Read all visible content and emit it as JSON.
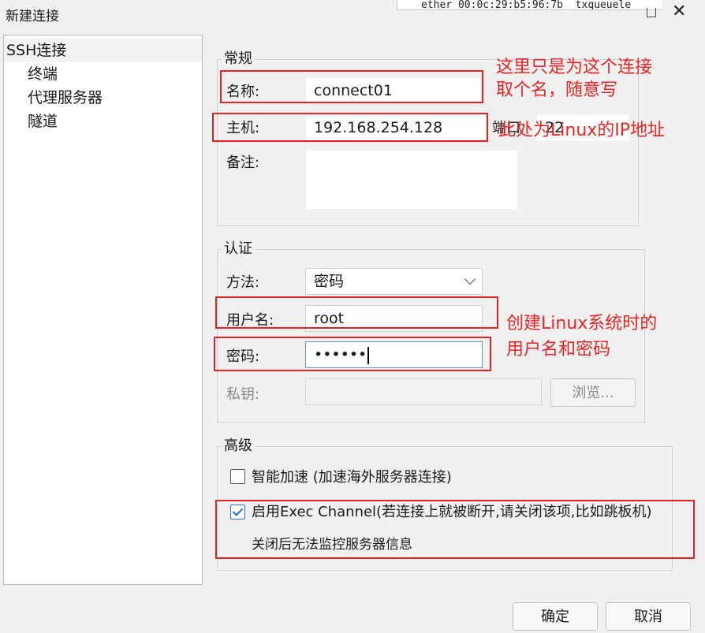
{
  "window": {
    "title": "新建连接",
    "close_glyph": "✕",
    "background_terminal_text": "ether 00:0c:29:b5:96:7b  txqueuele"
  },
  "sidebar": {
    "items": [
      {
        "label": "SSH连接",
        "selected": true
      },
      {
        "label": "终端"
      },
      {
        "label": "代理服务器"
      },
      {
        "label": "隧道"
      }
    ]
  },
  "general": {
    "title": "常规",
    "name_label": "名称:",
    "name_value": "connect01",
    "host_label": "主机:",
    "host_value": "192.168.254.128",
    "port_label": "端口",
    "port_value": "22",
    "remark_label": "备注:",
    "remark_value": ""
  },
  "auth": {
    "title": "认证",
    "method_label": "方法:",
    "method_value": "密码",
    "username_label": "用户名:",
    "username_value": "root",
    "password_label": "密码:",
    "password_value": "••••••",
    "privatekey_label": "私钥:",
    "privatekey_value": "",
    "browse_label": "浏览..."
  },
  "advanced": {
    "title": "高级",
    "smart_accel_label": "智能加速 (加速海外服务器连接)",
    "smart_accel_checked": false,
    "exec_channel_label": "启用Exec Channel(若连接上就被断开,请关闭该项,比如跳板机)",
    "exec_channel_checked": true,
    "exec_channel_note": "关闭后无法监控服务器信息"
  },
  "buttons": {
    "ok": "确定",
    "cancel": "取消"
  },
  "annotations": {
    "name_note_line1": "这里只是为这个连接",
    "name_note_line2": "取个名，随意写",
    "host_note": "此处为Linux的IP地址",
    "credentials_note_line1": "创建Linux系统时的",
    "credentials_note_line2": "用户名和密码",
    "color": "#e02222"
  },
  "colors": {
    "accent": "#2a6fd6",
    "annotation_red": "#e02222",
    "dialog_bg": "#f0f0f0"
  }
}
